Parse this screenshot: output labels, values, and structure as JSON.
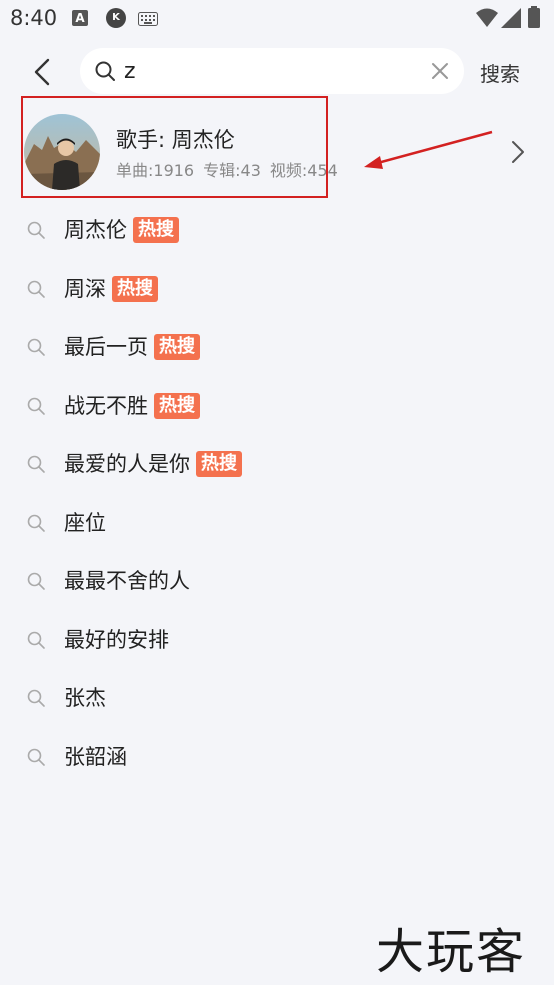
{
  "status_bar": {
    "time": "8:40",
    "icons": [
      "a-app-icon",
      "k-app-icon",
      "keyboard-icon",
      "wifi-icon",
      "signal-icon",
      "battery-icon"
    ]
  },
  "header": {
    "back_icon": "chevron-left-icon",
    "search": {
      "value": "z",
      "placeholder": "",
      "icon": "search-icon",
      "clear_icon": "close-icon"
    },
    "submit_label": "搜索"
  },
  "artist_card": {
    "title": "歌手: 周杰伦",
    "stats": {
      "singles": "单曲:1916",
      "albums": "专辑:43",
      "videos": "视频:454"
    },
    "annotation_color": "#d32121"
  },
  "suggestions": [
    {
      "text": "周杰伦",
      "badge": "热搜"
    },
    {
      "text": "周深",
      "badge": "热搜"
    },
    {
      "text": "最后一页",
      "badge": "热搜"
    },
    {
      "text": "战无不胜",
      "badge": "热搜"
    },
    {
      "text": "最爱的人是你",
      "badge": "热搜"
    },
    {
      "text": "座位",
      "badge": ""
    },
    {
      "text": "最最不舍的人",
      "badge": ""
    },
    {
      "text": "最好的安排",
      "badge": ""
    },
    {
      "text": "张杰",
      "badge": ""
    },
    {
      "text": "张韶涵",
      "badge": ""
    }
  ],
  "badge_color": "#f4714e",
  "watermark": "大玩客"
}
